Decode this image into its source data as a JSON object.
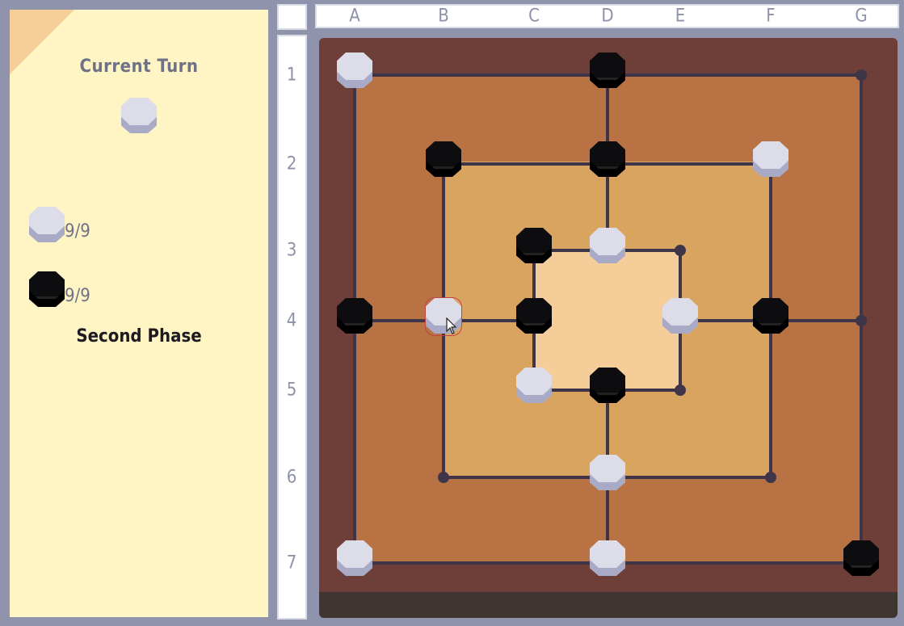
{
  "panel": {
    "turn_title": "Current Turn",
    "current_turn_color": "white",
    "white_count": "9/9",
    "black_count": "9/9",
    "phase": "Second Phase"
  },
  "columns": [
    "A",
    "B",
    "C",
    "D",
    "E",
    "F",
    "G"
  ],
  "rows": [
    "1",
    "2",
    "3",
    "4",
    "5",
    "6",
    "7"
  ],
  "colors": {
    "white_piece": "#dcdde9",
    "black_piece": "#0d0d10",
    "selection": "#c14447"
  },
  "board": {
    "selected": "B4",
    "pieces": [
      {
        "pos": "A1",
        "color": "white"
      },
      {
        "pos": "D1",
        "color": "black"
      },
      {
        "pos": "B2",
        "color": "black"
      },
      {
        "pos": "D2",
        "color": "black"
      },
      {
        "pos": "F2",
        "color": "white"
      },
      {
        "pos": "C3",
        "color": "black"
      },
      {
        "pos": "D3",
        "color": "white"
      },
      {
        "pos": "A4",
        "color": "black"
      },
      {
        "pos": "B4",
        "color": "white"
      },
      {
        "pos": "C4",
        "color": "black"
      },
      {
        "pos": "E4",
        "color": "white"
      },
      {
        "pos": "F4",
        "color": "black"
      },
      {
        "pos": "C5",
        "color": "white"
      },
      {
        "pos": "D5",
        "color": "black"
      },
      {
        "pos": "D6",
        "color": "white"
      },
      {
        "pos": "A7",
        "color": "white"
      },
      {
        "pos": "D7",
        "color": "white"
      },
      {
        "pos": "G7",
        "color": "black"
      }
    ],
    "empty_points": [
      "G1",
      "E3",
      "G4",
      "E5",
      "B6",
      "F6"
    ]
  }
}
